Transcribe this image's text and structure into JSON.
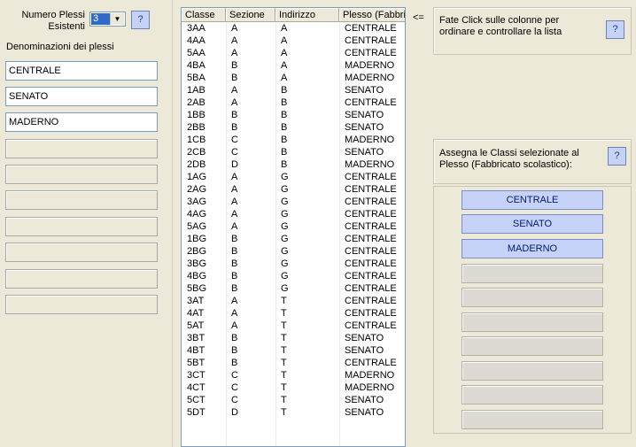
{
  "left": {
    "numero_label_line1": "Numero Plessi",
    "numero_label_line2": "Esistenti",
    "numero_value": "3",
    "help_label": "?",
    "denominazioni_label": "Denominazioni dei plessi",
    "plessi": [
      "CENTRALE",
      "SENATO",
      "MADERNO",
      "",
      "",
      "",
      "",
      "",
      "",
      ""
    ]
  },
  "table": {
    "columns": [
      "Classe",
      "Sezione",
      "Indirizzo",
      "Plesso (Fabbricato)"
    ],
    "rows": [
      [
        "3AA",
        "A",
        "A",
        "CENTRALE"
      ],
      [
        "4AA",
        "A",
        "A",
        "CENTRALE"
      ],
      [
        "5AA",
        "A",
        "A",
        "CENTRALE"
      ],
      [
        "4BA",
        "B",
        "A",
        "MADERNO"
      ],
      [
        "5BA",
        "B",
        "A",
        "MADERNO"
      ],
      [
        "1AB",
        "A",
        "B",
        "SENATO"
      ],
      [
        "2AB",
        "A",
        "B",
        "CENTRALE"
      ],
      [
        "1BB",
        "B",
        "B",
        "SENATO"
      ],
      [
        "2BB",
        "B",
        "B",
        "SENATO"
      ],
      [
        "1CB",
        "C",
        "B",
        "MADERNO"
      ],
      [
        "2CB",
        "C",
        "B",
        "SENATO"
      ],
      [
        "2DB",
        "D",
        "B",
        "MADERNO"
      ],
      [
        "1AG",
        "A",
        "G",
        "CENTRALE"
      ],
      [
        "2AG",
        "A",
        "G",
        "CENTRALE"
      ],
      [
        "3AG",
        "A",
        "G",
        "CENTRALE"
      ],
      [
        "4AG",
        "A",
        "G",
        "CENTRALE"
      ],
      [
        "5AG",
        "A",
        "G",
        "CENTRALE"
      ],
      [
        "1BG",
        "B",
        "G",
        "CENTRALE"
      ],
      [
        "2BG",
        "B",
        "G",
        "CENTRALE"
      ],
      [
        "3BG",
        "B",
        "G",
        "CENTRALE"
      ],
      [
        "4BG",
        "B",
        "G",
        "CENTRALE"
      ],
      [
        "5BG",
        "B",
        "G",
        "CENTRALE"
      ],
      [
        "3AT",
        "A",
        "T",
        "CENTRALE"
      ],
      [
        "4AT",
        "A",
        "T",
        "CENTRALE"
      ],
      [
        "5AT",
        "A",
        "T",
        "CENTRALE"
      ],
      [
        "3BT",
        "B",
        "T",
        "SENATO"
      ],
      [
        "4BT",
        "B",
        "T",
        "SENATO"
      ],
      [
        "5BT",
        "B",
        "T",
        "CENTRALE"
      ],
      [
        "3CT",
        "C",
        "T",
        "MADERNO"
      ],
      [
        "4CT",
        "C",
        "T",
        "MADERNO"
      ],
      [
        "5CT",
        "C",
        "T",
        "SENATO"
      ],
      [
        "5DT",
        "D",
        "T",
        "SENATO"
      ]
    ]
  },
  "right": {
    "arrow_label": "<=",
    "sort_hint_line1": "Fate Click sulle colonne per",
    "sort_hint_line2": "ordinare e controllare la lista",
    "assign_hint_line1": "Assegna le Classi selezionate al",
    "assign_hint_line2": "Plesso (Fabbricato scolastico):",
    "assign_buttons": [
      "CENTRALE",
      "SENATO",
      "MADERNO",
      "",
      "",
      "",
      "",
      "",
      "",
      ""
    ]
  },
  "colors": {
    "window_bg": "#ece9d8",
    "active_button": "#c7d2f8",
    "selection": "#316ac5"
  }
}
